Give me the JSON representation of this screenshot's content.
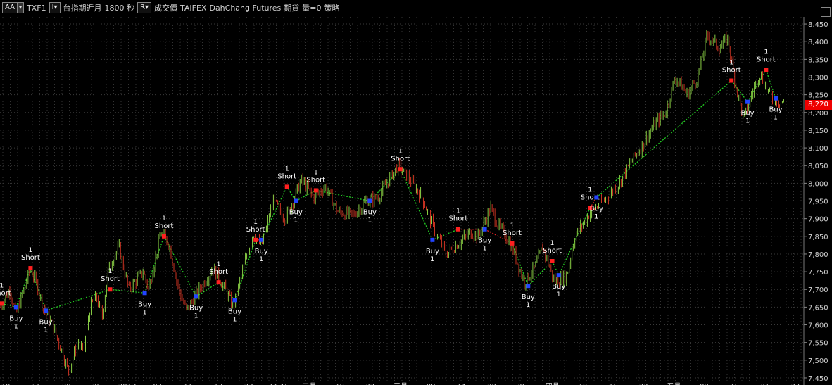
{
  "toolbar": {
    "aa_label": "AA",
    "aa_dropdown": "▾",
    "symbol": "TXF1",
    "symbol_button": "I▾",
    "name": "台指期近月",
    "interval": "1800 秒",
    "r_button": "R▾",
    "price_type": "成交價",
    "exchange": "TAIFEX",
    "source": "DahChang Futures",
    "category": "期貨",
    "volume": "量=0",
    "strategy": "策略"
  },
  "price_axis": {
    "labels": [
      "8,450",
      "8,400",
      "8,350",
      "8,300",
      "8,250",
      "8,200",
      "8,150",
      "8,100",
      "8,050",
      "8,000",
      "7,950",
      "7,900",
      "7,850",
      "7,800",
      "7,750",
      "7,700",
      "7,650",
      "7,600",
      "7,550",
      "7,500",
      "7,450"
    ],
    "current_price": "8,220",
    "current_price_color": "#e00000"
  },
  "date_axis": {
    "labels": [
      "10",
      "14",
      "20",
      "25",
      "2013",
      "07",
      "11",
      "17",
      "23",
      "11:15",
      "二月",
      "18",
      "22",
      "三月",
      "08",
      "14",
      "20",
      "26",
      "四月",
      "10",
      "16",
      "22",
      "五月",
      "09",
      "15",
      "21",
      "27"
    ]
  },
  "colors": {
    "background": "#000000",
    "up_bar": "#88cc44",
    "down_bar": "#cc3322",
    "short_marker": "#ff2020",
    "buy_marker": "#2244ff",
    "winning_trade_line": "#22cc22",
    "losing_trade_line": "#dd2222"
  },
  "chart_data": {
    "type": "candlestick",
    "ylim": [
      7440,
      8470
    ],
    "y_ticks": [
      8450,
      8400,
      8350,
      8300,
      8250,
      8200,
      8150,
      8100,
      8050,
      8000,
      7950,
      7900,
      7850,
      7800,
      7750,
      7700,
      7650,
      7600,
      7550,
      7500,
      7450
    ],
    "x_ticks": [
      "10",
      "14",
      "20",
      "25",
      "2013",
      "07",
      "11",
      "17",
      "23",
      "11:15",
      "二月",
      "18",
      "22",
      "三月",
      "08",
      "14",
      "20",
      "26",
      "四月",
      "10",
      "16",
      "22",
      "五月",
      "09",
      "15",
      "21",
      "27"
    ],
    "grid": true,
    "price_path": [
      [
        7650,
        0.0
      ],
      [
        7700,
        0.012
      ],
      [
        7630,
        0.02
      ],
      [
        7760,
        0.038
      ],
      [
        7720,
        0.045
      ],
      [
        7640,
        0.055
      ],
      [
        7600,
        0.065
      ],
      [
        7520,
        0.078
      ],
      [
        7470,
        0.085
      ],
      [
        7550,
        0.097
      ],
      [
        7520,
        0.104
      ],
      [
        7650,
        0.112
      ],
      [
        7680,
        0.12
      ],
      [
        7620,
        0.127
      ],
      [
        7760,
        0.135
      ],
      [
        7820,
        0.148
      ],
      [
        7700,
        0.16
      ],
      [
        7750,
        0.178
      ],
      [
        7700,
        0.185
      ],
      [
        7860,
        0.2
      ],
      [
        7830,
        0.21
      ],
      [
        7700,
        0.222
      ],
      [
        7640,
        0.232
      ],
      [
        7700,
        0.248
      ],
      [
        7760,
        0.265
      ],
      [
        7700,
        0.28
      ],
      [
        7650,
        0.29
      ],
      [
        7780,
        0.305
      ],
      [
        7860,
        0.315
      ],
      [
        7820,
        0.325
      ],
      [
        7950,
        0.34
      ],
      [
        7900,
        0.355
      ],
      [
        8010,
        0.375
      ],
      [
        7960,
        0.39
      ],
      [
        7990,
        0.405
      ],
      [
        7920,
        0.42
      ],
      [
        7910,
        0.44
      ],
      [
        7950,
        0.455
      ],
      [
        7960,
        0.47
      ],
      [
        8050,
        0.495
      ],
      [
        8010,
        0.51
      ],
      [
        7960,
        0.525
      ],
      [
        7870,
        0.54
      ],
      [
        7800,
        0.555
      ],
      [
        7830,
        0.57
      ],
      [
        7860,
        0.585
      ],
      [
        7850,
        0.595
      ],
      [
        7930,
        0.61
      ],
      [
        7880,
        0.62
      ],
      [
        7850,
        0.63
      ],
      [
        7800,
        0.64
      ],
      [
        7720,
        0.652
      ],
      [
        7760,
        0.665
      ],
      [
        7820,
        0.675
      ],
      [
        7720,
        0.69
      ],
      [
        7740,
        0.705
      ],
      [
        7850,
        0.715
      ],
      [
        7920,
        0.735
      ],
      [
        7960,
        0.755
      ],
      [
        8000,
        0.77
      ],
      [
        8060,
        0.785
      ],
      [
        8110,
        0.8
      ],
      [
        8170,
        0.815
      ],
      [
        8200,
        0.828
      ],
      [
        8300,
        0.84
      ],
      [
        8250,
        0.855
      ],
      [
        8300,
        0.868
      ],
      [
        8420,
        0.88
      ],
      [
        8380,
        0.895
      ],
      [
        8410,
        0.905
      ],
      [
        8280,
        0.915
      ],
      [
        8180,
        0.925
      ],
      [
        8250,
        0.935
      ],
      [
        8310,
        0.945
      ],
      [
        8240,
        0.96
      ],
      [
        8230,
        0.97
      ]
    ],
    "trades": [
      {
        "type": "short",
        "qty": "1",
        "label": "Short",
        "price": 7660,
        "x": 0.002
      },
      {
        "type": "buy",
        "qty": "1",
        "label": "Buy",
        "price": 7650,
        "x": 0.02
      },
      {
        "type": "short",
        "qty": "1",
        "label": "Short",
        "price": 7760,
        "x": 0.038
      },
      {
        "type": "buy",
        "qty": "1",
        "label": "Buy",
        "price": 7640,
        "x": 0.057
      },
      {
        "type": "short",
        "qty": "1",
        "label": "Short",
        "price": 7700,
        "x": 0.137
      },
      {
        "type": "buy",
        "qty": "1",
        "label": "Buy",
        "price": 7690,
        "x": 0.18
      },
      {
        "type": "short",
        "qty": "1",
        "label": "Short",
        "price": 7850,
        "x": 0.204
      },
      {
        "type": "buy",
        "qty": "1",
        "label": "Buy",
        "price": 7680,
        "x": 0.244
      },
      {
        "type": "short",
        "qty": "1",
        "label": "Short",
        "price": 7720,
        "x": 0.272
      },
      {
        "type": "buy",
        "qty": "1",
        "label": "Buy",
        "price": 7670,
        "x": 0.292
      },
      {
        "type": "short",
        "qty": "1",
        "label": "Short",
        "price": 7840,
        "x": 0.318
      },
      {
        "type": "buy",
        "qty": "1",
        "label": "Buy",
        "price": 7840,
        "x": 0.325
      },
      {
        "type": "short",
        "qty": "1",
        "label": "Short",
        "price": 7990,
        "x": 0.357
      },
      {
        "type": "buy",
        "qty": "1",
        "label": "Buy",
        "price": 7950,
        "x": 0.368
      },
      {
        "type": "short",
        "qty": "1",
        "label": "Short",
        "price": 7980,
        "x": 0.393
      },
      {
        "type": "buy",
        "qty": "1",
        "label": "Buy",
        "price": 7950,
        "x": 0.46
      },
      {
        "type": "short",
        "qty": "1",
        "label": "Short",
        "price": 8040,
        "x": 0.498
      },
      {
        "type": "buy",
        "qty": "1",
        "label": "Buy",
        "price": 7840,
        "x": 0.538
      },
      {
        "type": "short",
        "qty": "1",
        "label": "Short",
        "price": 7870,
        "x": 0.57
      },
      {
        "type": "buy",
        "qty": "1",
        "label": "Buy",
        "price": 7870,
        "x": 0.603
      },
      {
        "type": "short",
        "qty": "1",
        "label": "Short",
        "price": 7830,
        "x": 0.637
      },
      {
        "type": "buy",
        "qty": "1",
        "label": "Buy",
        "price": 7710,
        "x": 0.657
      },
      {
        "type": "short",
        "qty": "1",
        "label": "Short",
        "price": 7780,
        "x": 0.687
      },
      {
        "type": "buy",
        "qty": "1",
        "label": "Buy",
        "price": 7740,
        "x": 0.695
      },
      {
        "type": "short",
        "qty": "1",
        "label": "Short",
        "price": 7930,
        "x": 0.734
      },
      {
        "type": "buy",
        "qty": "1",
        "label": "Buy",
        "price": 7960,
        "x": 0.742
      },
      {
        "type": "short",
        "qty": "1",
        "label": "Short",
        "price": 8290,
        "x": 0.91
      },
      {
        "type": "buy",
        "qty": "1",
        "label": "Buy",
        "price": 8230,
        "x": 0.93
      },
      {
        "type": "short",
        "qty": "1",
        "label": "Short",
        "price": 8320,
        "x": 0.953
      },
      {
        "type": "buy",
        "qty": "1",
        "label": "Buy",
        "price": 8240,
        "x": 0.965
      }
    ]
  }
}
